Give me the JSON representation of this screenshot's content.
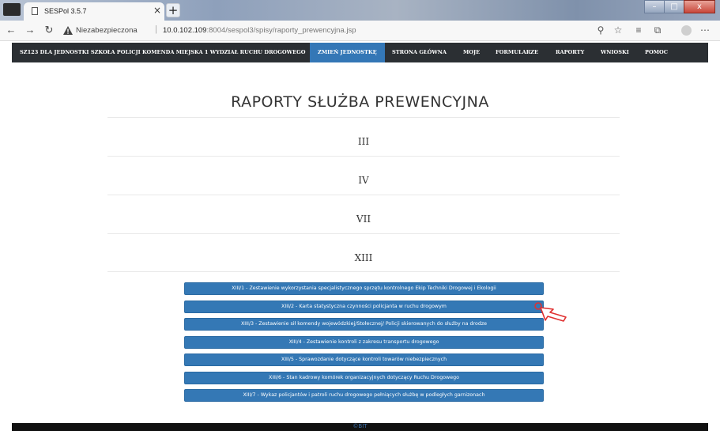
{
  "browser": {
    "tab_title": "SESPol 3.5.7",
    "tab_close": "×",
    "new_tab": "+",
    "insecure_label": "Niezabezpieczona",
    "url_host": "10.0.102.109",
    "url_rest": ":8004/sespol3/spisy/raporty_prewencyjna.jsp",
    "separator": "|"
  },
  "navbar": {
    "unit": "SZ123 DLA JEDNOSTKI SZKOŁA POLICJI KOMENDA MIEJSKA 1 WYDZIAŁ RUCHU DROGOWEGO",
    "change_unit": "ZMIEŃ JEDNOSTKĘ",
    "items": [
      "STRONA GŁÓWNA",
      "MOJE",
      "FORMULARZE",
      "RAPORTY",
      "WNIOSKI",
      "POMOC"
    ]
  },
  "page": {
    "title": "RAPORTY SŁUŻBA PREWENCYJNA",
    "sections": [
      "III",
      "IV",
      "VII",
      "XIII"
    ],
    "reports": [
      "XIII/1 - Zestawienie wykorzystania specjalistycznego sprzętu kontrolnego Ekip Techniki Drogowej i Ekologii",
      "XIII/2 - Karta statystyczna czynności policjanta w ruchu drogowym",
      "XIII/3 - Zestawienie sił komendy wojewódzkiej/Stołecznej/ Policji skierowanych do służby na drodze",
      "XIII/4 - Zestawienie kontroli z zakresu transportu drogowego",
      "XIII/5 - Sprawozdanie dotyczące kontroli towarów niebezpiecznych",
      "XIII/6 - Stan kadrowy komórek organizacyjnych dotyczący Ruchu Drogowego",
      "XIII/7 - Wykaz policjantów i patroli ruchu drogowego pełniących służbę w podległych garnizonach"
    ]
  },
  "footer": {
    "text": "©BIT"
  },
  "colors": {
    "navbar_bg": "#2b2f33",
    "accent": "#3478b5",
    "cursor": "#e03030"
  },
  "icons": {
    "back": "arrow-left-icon",
    "forward": "arrow-right-icon",
    "reload": "reload-icon",
    "warning": "warning-icon",
    "zoom": "zoom-icon",
    "favorite": "star-icon",
    "collections": "collections-icon",
    "extensions": "extensions-icon",
    "more": "more-icon"
  }
}
